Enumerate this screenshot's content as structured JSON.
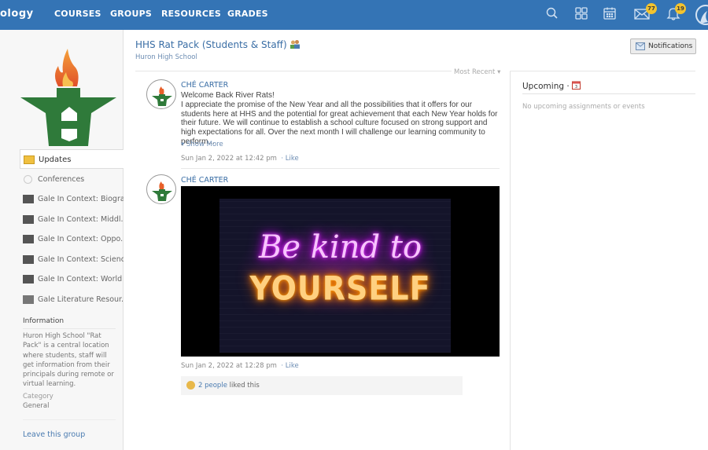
{
  "topbar": {
    "brand": "ology",
    "nav": [
      "COURSES",
      "GROUPS",
      "RESOURCES",
      "GRADES"
    ],
    "icons": [
      "search-icon",
      "apps-grid-icon",
      "calendar-icon",
      "mail-icon",
      "bell-icon",
      "user-avatar"
    ],
    "mail_badge": "77",
    "bell_badge": "19",
    "colors": {
      "bar": "#3474b5",
      "badge": "#f2c32f"
    }
  },
  "group": {
    "title": "HHS Rat Pack (Students & Staff)",
    "school": "Huron High School",
    "notifications_label": "Notifications"
  },
  "sidebar": {
    "items": [
      {
        "label": "Updates",
        "icon": "updates-icon",
        "active": true
      },
      {
        "label": "Conferences",
        "icon": "conferences-icon"
      },
      {
        "label": "Gale In Context: Biogra...",
        "icon": "resource-thumbnail"
      },
      {
        "label": "Gale In Context: Middl...",
        "icon": "resource-thumbnail"
      },
      {
        "label": "Gale In Context: Oppo...",
        "icon": "resource-thumbnail"
      },
      {
        "label": "Gale In Context: Science",
        "icon": "resource-thumbnail"
      },
      {
        "label": "Gale In Context: World ...",
        "icon": "resource-thumbnail"
      },
      {
        "label": "Gale Literature Resour...",
        "icon": "resource-thumbnail"
      }
    ],
    "info_title": "Information",
    "info_text": "Huron High School \"Rat Pack\" is a central location where students, staff will get information from their principals during remote or virtual learning.",
    "category_label": "Category",
    "category_value": "General",
    "leave_label": "Leave this group"
  },
  "feed": {
    "sort_label": "Most Recent",
    "posts": [
      {
        "author": "CHÉ CARTER",
        "heading": "Welcome Back River Rats!",
        "body": "I appreciate the promise of the New Year and all the possibilities that it offers for our students here at HHS and the potential for great achievement that each New Year holds for their future. We will continue to establish a school culture focused on strong support and high expectations for all. Over the next month I will challenge our learning community to perform...",
        "show_more": "Show More",
        "timestamp": "Sun Jan 2, 2022 at 12:42 pm",
        "like": "· Like"
      },
      {
        "author": "CHÉ CARTER",
        "image_text_line1": "Be kind to",
        "image_text_line2": "YOURSELF",
        "timestamp": "Sun Jan 2, 2022 at 12:28 pm",
        "like": "· Like",
        "likes_people": "2 people",
        "likes_suffix": " liked this"
      }
    ]
  },
  "upcoming": {
    "title": "Upcoming ·",
    "empty_text": "No upcoming assignments or events"
  }
}
